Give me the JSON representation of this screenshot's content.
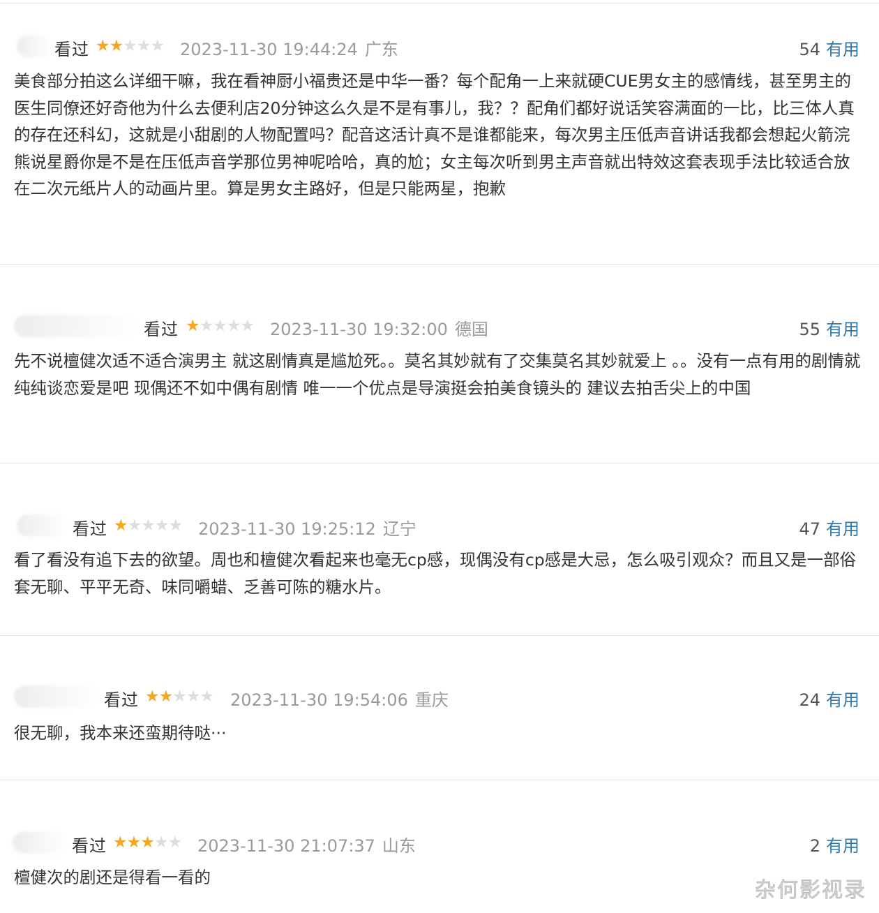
{
  "reviews": [
    {
      "status": "看过",
      "rating": 2,
      "datetime": "2023-11-30 19:44:24",
      "location": "广东",
      "votes": "54",
      "useful_label": "有用",
      "text": "美食部分拍这么详细干嘛，我在看神厨小福贵还是中华一番？每个配角一上来就硬CUE男女主的感情线，甚至男主的医生同僚还好奇他为什么去便利店20分钟这么久是不是有事儿，我？？配角们都好说话笑容满面的一比，比三体人真的存在还科幻，这就是小甜剧的人物配置吗？配音这活计真不是谁都能来，每次男主压低声音讲话我都会想起火箭浣熊说星爵你是不是在压低声音学那位男神呢哈哈，真的尬；女主每次听到男主声音就出特效这套表现手法比较适合放在二次元纸片人的动画片里。算是男女主路好，但是只能两星，抱歉"
    },
    {
      "status": "看过",
      "rating": 1,
      "datetime": "2023-11-30 19:32:00",
      "location": "德国",
      "votes": "55",
      "useful_label": "有用",
      "text": "先不说檀健次适不适合演男主 就这剧情真是尴尬死。。莫名其妙就有了交集莫名其妙就爱上 。。没有一点有用的剧情就纯纯谈恋爱是吧 现偶还不如中偶有剧情 唯一一个优点是导演挺会拍美食镜头的 建议去拍舌尖上的中国"
    },
    {
      "status": "看过",
      "rating": 1,
      "datetime": "2023-11-30 19:25:12",
      "location": "辽宁",
      "votes": "47",
      "useful_label": "有用",
      "text": "看了看没有追下去的欲望。周也和檀健次看起来也毫无cp感，现偶没有cp感是大忌，怎么吸引观众？而且又是一部俗套无聊、平平无奇、味同嚼蜡、乏善可陈的糖水片。"
    },
    {
      "status": "看过",
      "rating": 2,
      "datetime": "2023-11-30 19:54:06",
      "location": "重庆",
      "votes": "24",
      "useful_label": "有用",
      "text": "很无聊，我本来还蛮期待哒···"
    },
    {
      "status": "看过",
      "rating": 3,
      "datetime": "2023-11-30 21:07:37",
      "location": "山东",
      "votes": "2",
      "useful_label": "有用",
      "text": "檀健次的剧还是得看一看的"
    }
  ],
  "watermark": "杂何影视录",
  "colors": {
    "star_on": "#f5a623",
    "star_off": "#dddddd",
    "useful_link": "#3377aa",
    "meta_gray": "#9a9a9a"
  }
}
